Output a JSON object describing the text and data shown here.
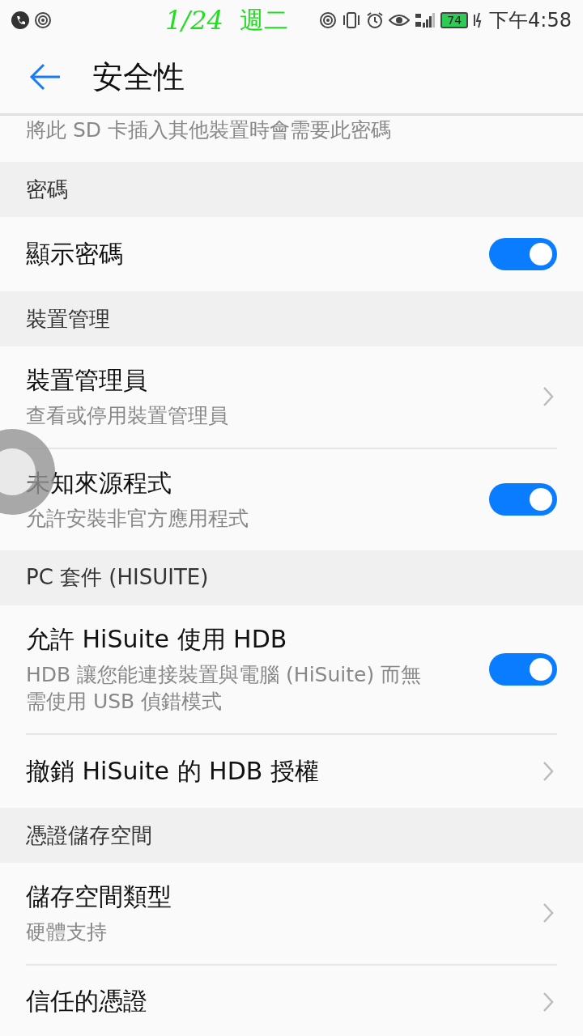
{
  "status_bar": {
    "date": "1/24",
    "weekday": "週二",
    "battery": "74",
    "time": "下午4:58"
  },
  "header": {
    "title": "安全性"
  },
  "sections": [
    {
      "items": [
        {
          "kind": "text",
          "subtitle": "將此 SD 卡插入其他裝置時會需要此密碼"
        }
      ]
    },
    {
      "title": "密碼",
      "items": [
        {
          "kind": "switch",
          "title": "顯示密碼",
          "on": true
        }
      ]
    },
    {
      "title": "裝置管理",
      "items": [
        {
          "kind": "link",
          "title": "裝置管理員",
          "subtitle": "查看或停用裝置管理員"
        },
        {
          "kind": "switch",
          "title": "未知來源程式",
          "subtitle": "允許安裝非官方應用程式",
          "on": true
        }
      ]
    },
    {
      "title": "PC 套件 (HISUITE)",
      "items": [
        {
          "kind": "switch",
          "title": "允許 HiSuite 使用 HDB",
          "subtitle": "HDB 讓您能連接裝置與電腦 (HiSuite) 而無需使用 USB 偵錯模式",
          "on": true
        },
        {
          "kind": "link",
          "title": "撤銷 HiSuite 的 HDB 授權"
        }
      ]
    },
    {
      "title": "憑證儲存空間",
      "items": [
        {
          "kind": "link",
          "title": "儲存空間類型",
          "subtitle": "硬體支持"
        },
        {
          "kind": "link",
          "title": "信任的憑證"
        }
      ]
    }
  ]
}
